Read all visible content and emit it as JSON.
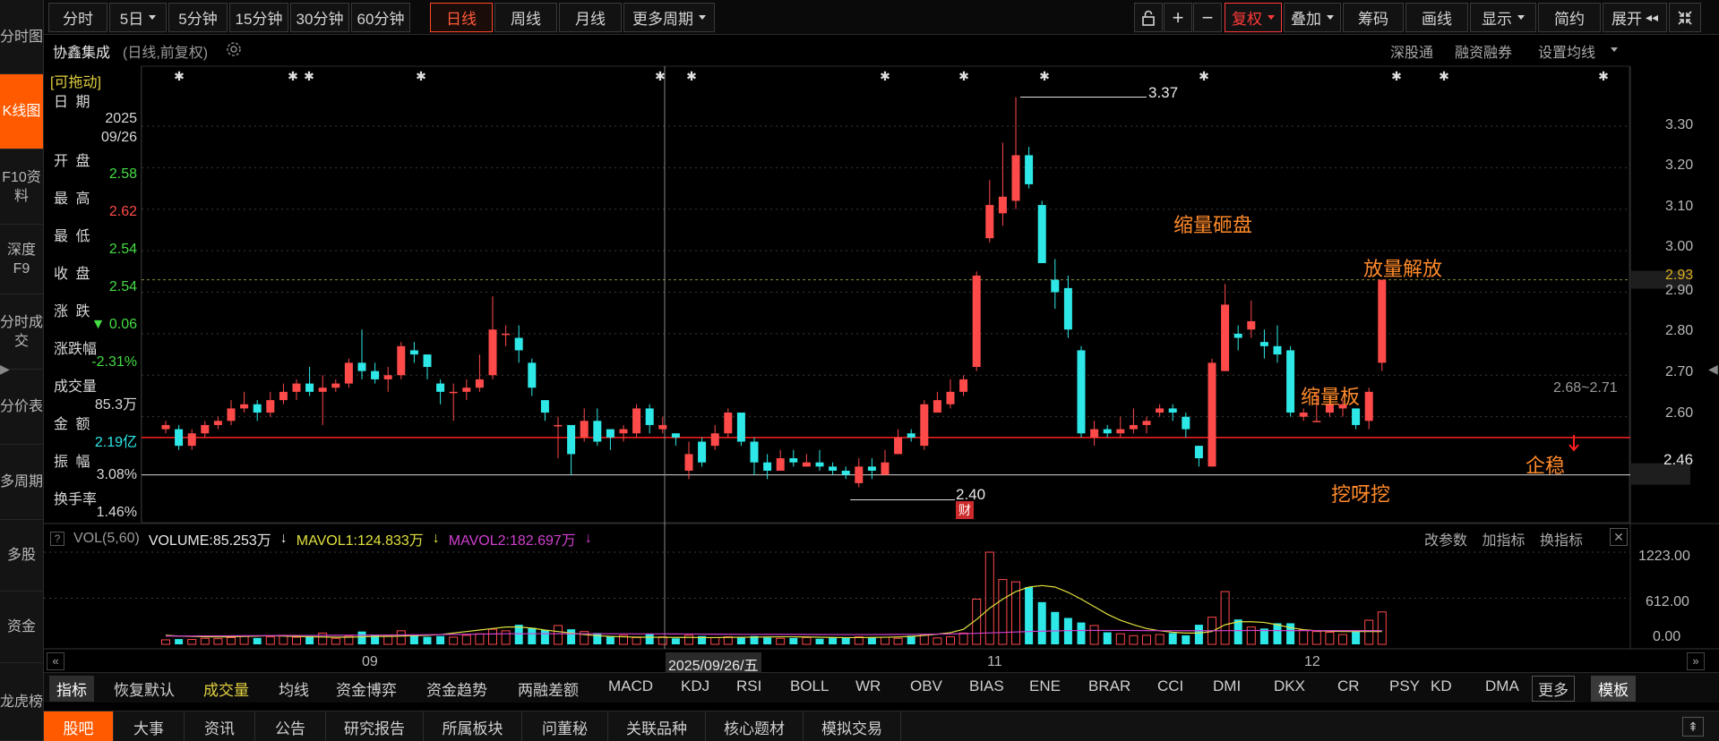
{
  "colors": {
    "up": "#ff4a4a",
    "down": "#2ee8e8",
    "accent": "#ff5a00",
    "ma_white": "#d8d8d8",
    "ma_yellow": "#e0e040",
    "ma_magenta": "#d040d0"
  },
  "leftnav": [
    {
      "label": "分时图"
    },
    {
      "label": "K线图",
      "active": true
    },
    {
      "label": "F10资料"
    },
    {
      "label": "深度F9"
    },
    {
      "label": "分时成交"
    },
    {
      "label": "分价表"
    },
    {
      "label": "多周期"
    },
    {
      "label": "多股"
    },
    {
      "label": "资金"
    },
    {
      "label": "龙虎榜"
    }
  ],
  "toolbar": {
    "periods": [
      "分时",
      "5日",
      "5分钟",
      "15分钟",
      "30分钟",
      "60分钟",
      "日线",
      "周线",
      "月线",
      "更多周期"
    ],
    "active_period": "日线",
    "lock_icon": "lock-icon",
    "plus_icon": "plus-icon",
    "minus_icon": "minus-icon",
    "right": [
      "复权",
      "叠加",
      "筹码",
      "画线",
      "显示",
      "简约",
      "展开"
    ]
  },
  "title": {
    "name": "协鑫集成",
    "mode": "(日线,前复权)",
    "gear_icon": "gear-icon",
    "links": [
      "深股通",
      "融资融券",
      "设置均线"
    ]
  },
  "info": {
    "drag": "[可拖动]",
    "rows": [
      {
        "label": "日 期",
        "value": "2025\n09/26",
        "color": "#d8d8d8"
      },
      {
        "label": "开 盘",
        "value": "2.58",
        "color": "#44dd44"
      },
      {
        "label": "最 高",
        "value": "2.62",
        "color": "#ff4a4a"
      },
      {
        "label": "最 低",
        "value": "2.54",
        "color": "#44dd44"
      },
      {
        "label": "收 盘",
        "value": "2.54",
        "color": "#44dd44"
      },
      {
        "label": "涨 跌",
        "value": "▼ 0.06",
        "color": "#44dd44"
      },
      {
        "label": "涨跌幅",
        "value": "-2.31%",
        "color": "#44dd44"
      },
      {
        "label": "成交量",
        "value": "85.3万",
        "color": "#d8d8d8"
      },
      {
        "label": "金 额",
        "value": "2.19亿",
        "color": "#2ee8e8"
      },
      {
        "label": "振 幅",
        "value": "3.08%",
        "color": "#d8d8d8"
      },
      {
        "label": "换手率",
        "value": "1.46%",
        "color": "#d8d8d8"
      }
    ]
  },
  "price_axis": {
    "ticks": [
      "3.30",
      "3.20",
      "3.10",
      "3.00",
      "2.90",
      "2.80",
      "2.70",
      "2.60"
    ],
    "current_price": "2.93",
    "support_level": "2.46",
    "ylim": [
      2.36,
      3.44
    ]
  },
  "annotations": {
    "high": "3.37",
    "low": "2.40",
    "fin_badge": "财",
    "labels": [
      "缩量砸盘",
      "放量解放",
      "缩量板",
      "挖呀挖",
      "企稳"
    ],
    "last_range": "2.68~2.71"
  },
  "chart_data": {
    "type": "candlestick",
    "x_ticks": [
      "09",
      "11",
      "12"
    ],
    "cursor_date": "2025/09/26/五",
    "candles": [
      [
        2.57,
        2.58,
        2.59,
        2.56
      ],
      [
        2.57,
        2.53,
        2.58,
        2.52
      ],
      [
        2.53,
        2.56,
        2.57,
        2.52
      ],
      [
        2.56,
        2.58,
        2.59,
        2.55
      ],
      [
        2.58,
        2.59,
        2.6,
        2.57
      ],
      [
        2.59,
        2.62,
        2.64,
        2.58
      ],
      [
        2.62,
        2.63,
        2.66,
        2.61
      ],
      [
        2.63,
        2.61,
        2.64,
        2.59
      ],
      [
        2.61,
        2.64,
        2.66,
        2.6
      ],
      [
        2.64,
        2.66,
        2.68,
        2.63
      ],
      [
        2.66,
        2.68,
        2.69,
        2.64
      ],
      [
        2.68,
        2.66,
        2.72,
        2.65
      ],
      [
        2.66,
        2.67,
        2.7,
        2.58
      ],
      [
        2.67,
        2.68,
        2.69,
        2.66
      ],
      [
        2.68,
        2.73,
        2.74,
        2.67
      ],
      [
        2.73,
        2.71,
        2.81,
        2.69
      ],
      [
        2.71,
        2.69,
        2.73,
        2.68
      ],
      [
        2.69,
        2.7,
        2.72,
        2.66
      ],
      [
        2.7,
        2.77,
        2.78,
        2.69
      ],
      [
        2.76,
        2.75,
        2.78,
        2.73
      ],
      [
        2.75,
        2.72,
        2.75,
        2.69
      ],
      [
        2.68,
        2.66,
        2.69,
        2.63
      ],
      [
        2.66,
        2.66,
        2.68,
        2.59
      ],
      [
        2.66,
        2.67,
        2.69,
        2.64
      ],
      [
        2.67,
        2.69,
        2.75,
        2.66
      ],
      [
        2.7,
        2.81,
        2.89,
        2.69
      ],
      [
        2.8,
        2.8,
        2.82,
        2.77
      ],
      [
        2.79,
        2.76,
        2.82,
        2.73
      ],
      [
        2.73,
        2.67,
        2.74,
        2.65
      ],
      [
        2.64,
        2.61,
        2.64,
        2.59
      ],
      [
        2.58,
        2.58,
        2.6,
        2.5
      ],
      [
        2.58,
        2.51,
        2.58,
        2.46
      ],
      [
        2.55,
        2.59,
        2.62,
        2.54
      ],
      [
        2.59,
        2.54,
        2.62,
        2.53
      ],
      [
        2.57,
        2.55,
        2.57,
        2.52
      ],
      [
        2.56,
        2.57,
        2.58,
        2.54
      ],
      [
        2.56,
        2.62,
        2.63,
        2.55
      ],
      [
        2.62,
        2.58,
        2.63,
        2.56
      ],
      [
        2.57,
        2.58,
        2.6,
        2.56
      ],
      [
        2.56,
        2.55,
        2.56,
        2.53
      ],
      [
        2.47,
        2.51,
        2.54,
        2.45
      ],
      [
        2.54,
        2.49,
        2.55,
        2.48
      ],
      [
        2.53,
        2.56,
        2.58,
        2.52
      ],
      [
        2.56,
        2.61,
        2.62,
        2.55
      ],
      [
        2.61,
        2.54,
        2.61,
        2.53
      ],
      [
        2.54,
        2.49,
        2.55,
        2.46
      ],
      [
        2.49,
        2.47,
        2.51,
        2.45
      ],
      [
        2.47,
        2.5,
        2.52,
        2.47
      ],
      [
        2.5,
        2.49,
        2.52,
        2.48
      ],
      [
        2.48,
        2.49,
        2.51,
        2.48
      ],
      [
        2.49,
        2.48,
        2.52,
        2.47
      ],
      [
        2.48,
        2.47,
        2.49,
        2.46
      ],
      [
        2.47,
        2.46,
        2.48,
        2.45
      ],
      [
        2.44,
        2.48,
        2.5,
        2.43
      ],
      [
        2.48,
        2.47,
        2.5,
        2.45
      ],
      [
        2.46,
        2.49,
        2.52,
        2.46
      ],
      [
        2.51,
        2.55,
        2.57,
        2.51
      ],
      [
        2.56,
        2.55,
        2.57,
        2.54
      ],
      [
        2.53,
        2.63,
        2.64,
        2.52
      ],
      [
        2.61,
        2.64,
        2.66,
        2.61
      ],
      [
        2.63,
        2.66,
        2.69,
        2.62
      ],
      [
        2.66,
        2.69,
        2.7,
        2.65
      ],
      [
        2.72,
        2.94,
        2.95,
        2.71
      ],
      [
        3.03,
        3.11,
        3.17,
        3.02
      ],
      [
        3.09,
        3.13,
        3.26,
        3.06
      ],
      [
        3.12,
        3.23,
        3.37,
        3.1
      ],
      [
        3.23,
        3.16,
        3.25,
        3.15
      ],
      [
        3.11,
        2.97,
        3.12,
        2.97
      ],
      [
        2.93,
        2.9,
        2.98,
        2.86
      ],
      [
        2.91,
        2.81,
        2.94,
        2.79
      ],
      [
        2.76,
        2.56,
        2.77,
        2.55
      ],
      [
        2.55,
        2.57,
        2.59,
        2.53
      ],
      [
        2.57,
        2.56,
        2.58,
        2.55
      ],
      [
        2.56,
        2.57,
        2.6,
        2.55
      ],
      [
        2.57,
        2.58,
        2.62,
        2.56
      ],
      [
        2.58,
        2.59,
        2.6,
        2.56
      ],
      [
        2.61,
        2.62,
        2.63,
        2.6
      ],
      [
        2.62,
        2.61,
        2.63,
        2.59
      ],
      [
        2.6,
        2.57,
        2.61,
        2.55
      ],
      [
        2.53,
        2.5,
        2.53,
        2.48
      ],
      [
        2.48,
        2.73,
        2.74,
        2.48
      ],
      [
        2.71,
        2.87,
        2.92,
        2.71
      ],
      [
        2.8,
        2.79,
        2.82,
        2.76
      ],
      [
        2.81,
        2.83,
        2.88,
        2.79
      ],
      [
        2.78,
        2.77,
        2.81,
        2.74
      ],
      [
        2.77,
        2.75,
        2.82,
        2.73
      ],
      [
        2.76,
        2.61,
        2.77,
        2.6
      ],
      [
        2.6,
        2.61,
        2.62,
        2.59
      ],
      [
        2.59,
        2.59,
        2.66,
        2.59
      ],
      [
        2.61,
        2.63,
        2.65,
        2.6
      ],
      [
        2.62,
        2.63,
        2.64,
        2.6
      ],
      [
        2.62,
        2.58,
        2.62,
        2.57
      ],
      [
        2.59,
        2.66,
        2.67,
        2.57
      ],
      [
        2.73,
        2.93,
        2.93,
        2.71
      ]
    ],
    "vol_ma1": [
      120,
      110,
      105,
      100,
      98,
      100,
      105,
      110,
      115,
      110,
      105,
      100,
      98,
      95,
      95,
      100,
      105,
      105,
      110,
      115,
      120,
      130,
      150,
      170,
      190,
      210,
      230,
      230,
      215,
      190,
      170,
      150,
      130,
      115,
      105,
      100,
      95,
      95,
      93,
      92,
      92,
      90,
      90,
      92,
      94,
      96,
      98,
      100,
      100,
      98,
      95,
      92,
      90,
      90,
      92,
      94,
      98,
      105,
      118,
      135,
      155,
      200,
      330,
      480,
      600,
      700,
      760,
      780,
      760,
      690,
      600,
      500,
      400,
      320,
      260,
      210,
      180,
      160,
      150,
      150,
      170,
      260,
      300,
      300,
      290,
      260,
      220,
      195,
      180,
      175,
      170,
      170,
      170,
      170
    ],
    "vol_ma2": [
      110,
      110,
      110,
      112,
      112,
      113,
      114,
      115,
      116,
      117,
      118,
      118,
      119,
      120,
      121,
      122,
      123,
      124,
      125,
      126,
      128,
      130,
      132,
      134,
      136,
      138,
      140,
      141,
      142,
      142,
      141,
      140,
      140,
      140,
      140,
      140,
      139,
      139,
      139,
      138,
      137,
      136,
      135,
      134,
      133,
      133,
      132,
      132,
      132,
      131,
      131,
      130,
      130,
      130,
      130,
      131,
      132,
      133,
      134,
      136,
      138,
      141,
      146,
      152,
      158,
      164,
      170,
      175,
      179,
      182,
      184,
      185,
      185,
      185,
      184,
      183,
      182,
      182,
      181,
      181,
      181,
      182,
      183,
      184,
      184,
      183,
      183,
      183,
      183,
      183,
      183,
      183,
      183,
      183
    ],
    "volume": {
      "header": "VOL(5,60)",
      "volume": "VOLUME:85.253万",
      "mavol1": "MAVOL1:124.833万",
      "mavol2": "MAVOL2:182.697万",
      "ticks": [
        "1223.00",
        "612.00",
        "0.00"
      ],
      "ylim": [
        0,
        1223
      ]
    },
    "volumes": [
      60,
      70,
      65,
      80,
      75,
      90,
      110,
      85,
      100,
      120,
      95,
      110,
      150,
      80,
      110,
      170,
      120,
      110,
      180,
      130,
      100,
      110,
      95,
      120,
      140,
      200,
      180,
      260,
      220,
      190,
      250,
      200,
      170,
      150,
      110,
      120,
      90,
      140,
      100,
      80,
      120,
      110,
      90,
      100,
      95,
      110,
      90,
      80,
      85,
      90,
      75,
      90,
      85,
      100,
      90,
      95,
      80,
      115,
      130,
      85,
      100,
      150,
      600,
      1223,
      860,
      830,
      760,
      560,
      430,
      350,
      290,
      250,
      160,
      140,
      115,
      120,
      130,
      150,
      120,
      260,
      360,
      700,
      330,
      230,
      210,
      280,
      280,
      190,
      170,
      160,
      130,
      180,
      320,
      430
    ]
  },
  "volume_panel_links": [
    "改参数",
    "加指标",
    "换指标"
  ],
  "indicator_tabs": [
    "指标",
    "恢复默认",
    "成交量",
    "均线",
    "资金博弈",
    "资金趋势",
    "两融差额",
    "MACD",
    "KDJ",
    "RSI",
    "BOLL",
    "WR",
    "OBV",
    "BIAS",
    "ENE",
    "BRAR",
    "CCI",
    "DMI",
    "DKX",
    "CR",
    "PSY",
    "KD",
    "DMA",
    "更多",
    "模板"
  ],
  "bottom_tabs": [
    "股吧",
    "大事",
    "资讯",
    "公告",
    "研究报告",
    "所属板块",
    "问董秘",
    "关联品种",
    "核心题材",
    "模拟交易"
  ]
}
